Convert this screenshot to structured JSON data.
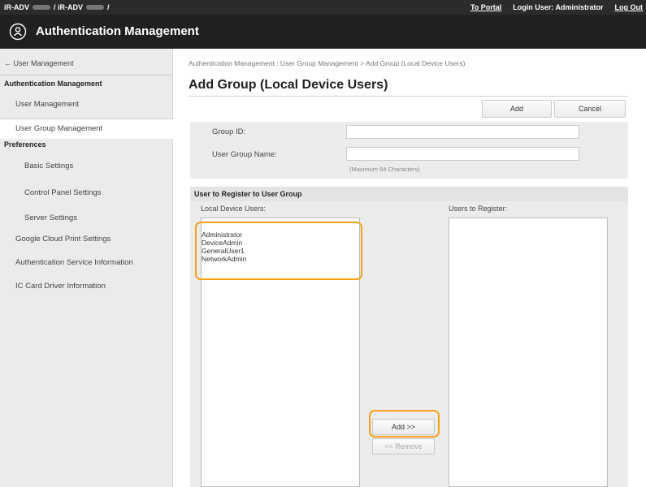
{
  "topbar": {
    "device_prefix": "iR-ADV",
    "device_mid": "/ iR-ADV",
    "device_suffix": "/",
    "to_portal": "To Portal",
    "login_user_label": "Login User:",
    "login_user_value": "Administrator",
    "logout": "Log Out"
  },
  "header": {
    "title": "Authentication Management"
  },
  "sidebar": {
    "back": "← User Management",
    "section_auth": "Authentication Management",
    "user_management": "User Management",
    "user_group_management": "User Group Management",
    "section_prefs": "Preferences",
    "basic_settings": "Basic Settings",
    "control_panel_settings": "Control Panel Settings",
    "server_settings": "Server Settings",
    "google_cloud_print": "Google Cloud Print Settings",
    "auth_service_info": "Authentication Service Information",
    "ic_card_driver_info": "IC Card Driver Information"
  },
  "main": {
    "breadcrumb": "Authentication Management : User Group Management > Add Group (Local Device Users)",
    "title": "Add Group (Local Device Users)",
    "add_label": "Add",
    "cancel_label": "Cancel",
    "group_id_label": "Group ID:",
    "group_id_value": "",
    "user_group_name_label": "User Group Name:",
    "user_group_name_value": "",
    "max_chars_hint": "(Maximum 64 Characters)",
    "register_heading": "User to Register to User Group",
    "local_users_label": "Local Device Users:",
    "users_to_register_label": "Users to Register:",
    "local_users": [
      "Administrator",
      "DeviceAdmin",
      "GeneralUser1",
      "NetworkAdmin"
    ],
    "add_arrow_label": "Add >>",
    "remove_label": "<< Remove"
  },
  "colors": {
    "highlight": "#f2a21b",
    "header_bg": "#202020",
    "topbar_bg": "#2b2b2b"
  }
}
